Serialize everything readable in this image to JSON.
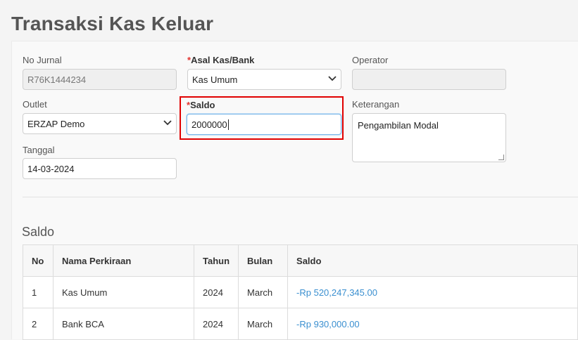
{
  "page": {
    "title": "Transaksi Kas Keluar"
  },
  "form": {
    "no_jurnal": {
      "label": "No Jurnal",
      "value": "R76K1444234"
    },
    "asal_kas": {
      "required_mark": "*",
      "label": "Asal Kas/Bank",
      "value": "Kas Umum"
    },
    "operator": {
      "label": "Operator",
      "value": ""
    },
    "outlet": {
      "label": "Outlet",
      "value": "ERZAP Demo"
    },
    "saldo": {
      "required_mark": "*",
      "label": "Saldo",
      "value": "2000000"
    },
    "keterangan": {
      "label": "Keterangan",
      "value": "Pengambilan Modal"
    },
    "tanggal": {
      "label": "Tanggal",
      "value": "14-03-2024"
    }
  },
  "saldo_section": {
    "title": "Saldo",
    "columns": [
      "No",
      "Nama Perkiraan",
      "Tahun",
      "Bulan",
      "Saldo"
    ],
    "rows": [
      {
        "no": "1",
        "nama": "Kas Umum",
        "tahun": "2024",
        "bulan": "March",
        "saldo": "-Rp 520,247,345.00"
      },
      {
        "no": "2",
        "nama": "Bank BCA",
        "tahun": "2024",
        "bulan": "March",
        "saldo": "-Rp 930,000.00"
      }
    ]
  },
  "colors": {
    "accent_amount": "#3a8fd0",
    "required": "#e3342f",
    "highlight": "#e00000"
  }
}
